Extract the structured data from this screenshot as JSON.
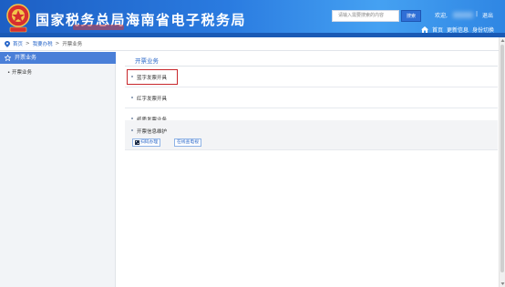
{
  "header": {
    "site_title": "国家税务总局海南省电子税务局",
    "search_placeholder": "请输入需要搜索的内容",
    "search_button": "搜索",
    "welcome": "欢迎,",
    "separator": "|",
    "logout": "退出",
    "links": [
      "首页",
      "更新信息",
      "身份切换"
    ],
    "colors": {
      "brand_blue": "#2a7be0",
      "accent_red": "#c8262b"
    }
  },
  "breadcrumb": {
    "items": [
      "首页",
      "我要办税",
      "开票业务"
    ],
    "separator": ">"
  },
  "sidebar": {
    "header_label": "开票业务",
    "items": [
      "开票业务"
    ]
  },
  "main": {
    "section_title": "开票业务",
    "rows": [
      "蓝字发票开具",
      "红字发票开具",
      "纸质发票业务",
      "开票信息维护"
    ],
    "buttons": [
      "扫码办理",
      "在线查电视"
    ]
  }
}
